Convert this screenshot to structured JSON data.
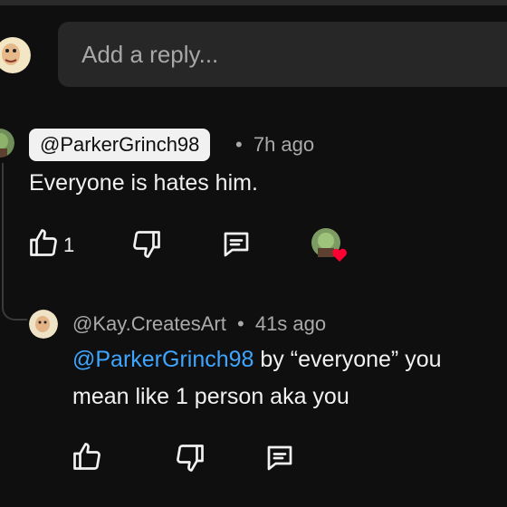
{
  "reply": {
    "placeholder": "Add a reply..."
  },
  "comment": {
    "author": "@ParkerGrinch98",
    "separator": "•",
    "time": "7h ago",
    "text": "Everyone is hates him.",
    "like_count": "1"
  },
  "reply_comment": {
    "author": "@Kay.CreatesArt",
    "separator": "•",
    "time": "41s ago",
    "mention": "@ParkerGrinch98",
    "text_line1_rest": " by “everyone” you",
    "text_line2": "mean like 1 person aka you"
  },
  "colors": {
    "background": "#0f0f0f",
    "mention": "#3ea6ff",
    "heart": "#ff0033"
  },
  "icons": [
    "thumb-up-icon",
    "thumb-down-icon",
    "reply-comment-icon",
    "heart-icon"
  ]
}
